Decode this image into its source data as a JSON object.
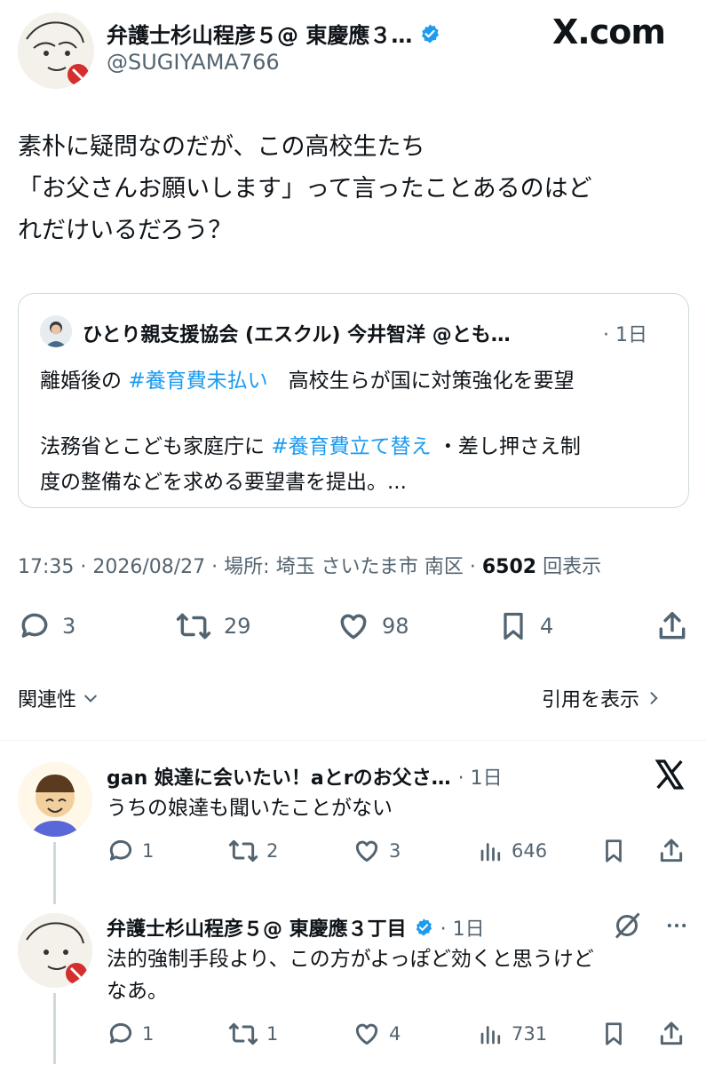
{
  "header": {
    "author_name": "弁護士杉山程彦５@ 東慶應３…",
    "handle": "@SUGIYAMA766",
    "brand": "X.com"
  },
  "tweet": {
    "lines": [
      "素朴に疑問なのだが、この高校生たち",
      "「お父さんお願いします」って言ったことあるのはど",
      "れだけいるだろう？"
    ]
  },
  "quote": {
    "author": "ひとり親支援協会 (エスクル) 今井智洋 @とも…",
    "time": "· 1日",
    "line1_a": "離婚後の ",
    "line1_tag": "#養育費未払い",
    "line1_b": "　高校生らが国に対策強化を要望",
    "line2_a": "法務省とこども家庭庁に ",
    "line2_tag": "#養育費立て替え",
    "line2_b": " ・差し押さえ制",
    "line3": "度の整備などを求める要望書を提出。..."
  },
  "meta": {
    "text": "17:35 · 2026/08/27 · 場所: 埼玉 さいたま市 南区 · ",
    "views": "6502",
    "views_label": " 回表示"
  },
  "actions": {
    "replies": "3",
    "retweets": "29",
    "likes": "98",
    "bookmarks": "4"
  },
  "filters": {
    "relevance": "関連性",
    "view_quotes": "引用を表示"
  },
  "replies": [
    {
      "name": "gan 娘達に会いたい！aとrのお父さ…",
      "time": "· 1日",
      "text": "うちの娘達も聞いたことがない",
      "replies": "1",
      "retweets": "2",
      "likes": "3",
      "views": "646"
    },
    {
      "name": "弁護士杉山程彦５@ 東慶應３丁目",
      "time": "· 1日",
      "text_line1": "法的強制手段より、この方がよっぽど効くと思うけど",
      "text_line2": "なあ。",
      "replies": "1",
      "retweets": "1",
      "likes": "4",
      "views": "731"
    }
  ],
  "colors": {
    "accent": "#1d9bf0",
    "secondary_text": "#536471",
    "border": "#cfd9de"
  }
}
